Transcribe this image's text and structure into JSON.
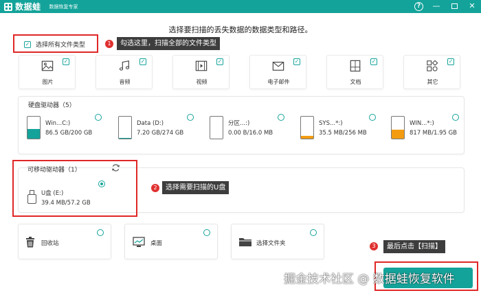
{
  "app": {
    "name": "数据蛙",
    "subtitle": "数据恢复专家",
    "help_label": "?",
    "minimize_label": "—",
    "close_label": "✕"
  },
  "heading": "选择要扫描的丢失数据的数据类型和路径。",
  "select_all": {
    "label": "选择所有文件类型",
    "checked": true
  },
  "callouts": [
    {
      "number": "1",
      "text": "勾选这里，扫描全部的文件类型"
    },
    {
      "number": "2",
      "text": "选择需要扫描的U盘"
    },
    {
      "number": "3",
      "text": "最后点击【扫描】"
    }
  ],
  "file_types": [
    {
      "label": "图片",
      "icon": "image-icon",
      "checked": true
    },
    {
      "label": "音频",
      "icon": "music-icon",
      "checked": true
    },
    {
      "label": "视频",
      "icon": "video-icon",
      "checked": true
    },
    {
      "label": "电子邮件",
      "icon": "mail-icon",
      "checked": true
    },
    {
      "label": "文档",
      "icon": "document-icon",
      "checked": true
    },
    {
      "label": "其它",
      "icon": "other-icon",
      "checked": true
    }
  ],
  "hard_drives": {
    "title": "硬盘驱动器（5）",
    "drives": [
      {
        "name": "Win...C:)",
        "size": "86.5 GB/200 GB",
        "fill_fraction": 0.43,
        "fill_color": "#14a39a"
      },
      {
        "name": "Data (D:)",
        "size": "7.20 GB/274 GB",
        "fill_fraction": 0.03,
        "fill_color": "#14a39a"
      },
      {
        "name": "分区...:)",
        "size": "0.00  B/16.0 MB",
        "fill_fraction": 0.0,
        "fill_color": "#14a39a"
      },
      {
        "name": "SYS...*:)",
        "size": "35.5 MB/256 MB",
        "fill_fraction": 0.14,
        "fill_color": "#f39c12"
      },
      {
        "name": "WIN...*:)",
        "size": "817 MB/1.95 GB",
        "fill_fraction": 0.42,
        "fill_color": "#f39c12"
      }
    ]
  },
  "removable": {
    "title": "可移动驱动器（1）",
    "refresh_icon": "refresh-icon",
    "drive": {
      "name": "U盘 (E:)",
      "size": "39.4 MB/57.2 GB",
      "selected": true
    }
  },
  "locations": [
    {
      "label": "回收站",
      "icon": "trash-icon"
    },
    {
      "label": "桌面",
      "icon": "desktop-icon"
    },
    {
      "label": "选择文件夹",
      "icon": "folder-icon"
    }
  ],
  "watermark": "掘金技术社区 @ 数据蛙恢复软件",
  "colors": {
    "accent": "#14a39a",
    "highlight": "#e02626",
    "warning_fill": "#f39c12"
  }
}
